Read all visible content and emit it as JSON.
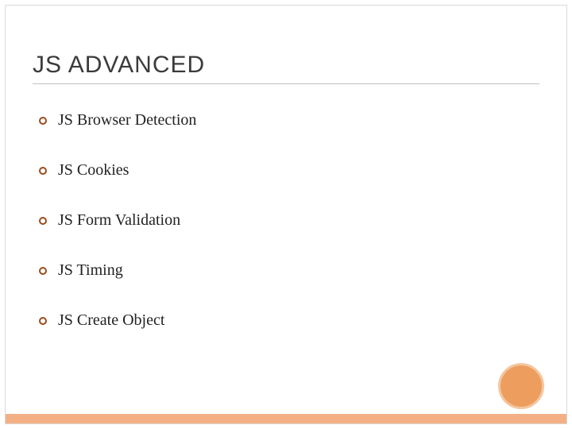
{
  "title": "JS ADVANCED",
  "items": [
    "JS Browser Detection",
    "JS Cookies",
    "JS Form Validation",
    "JS Timing",
    "JS Create Object"
  ]
}
